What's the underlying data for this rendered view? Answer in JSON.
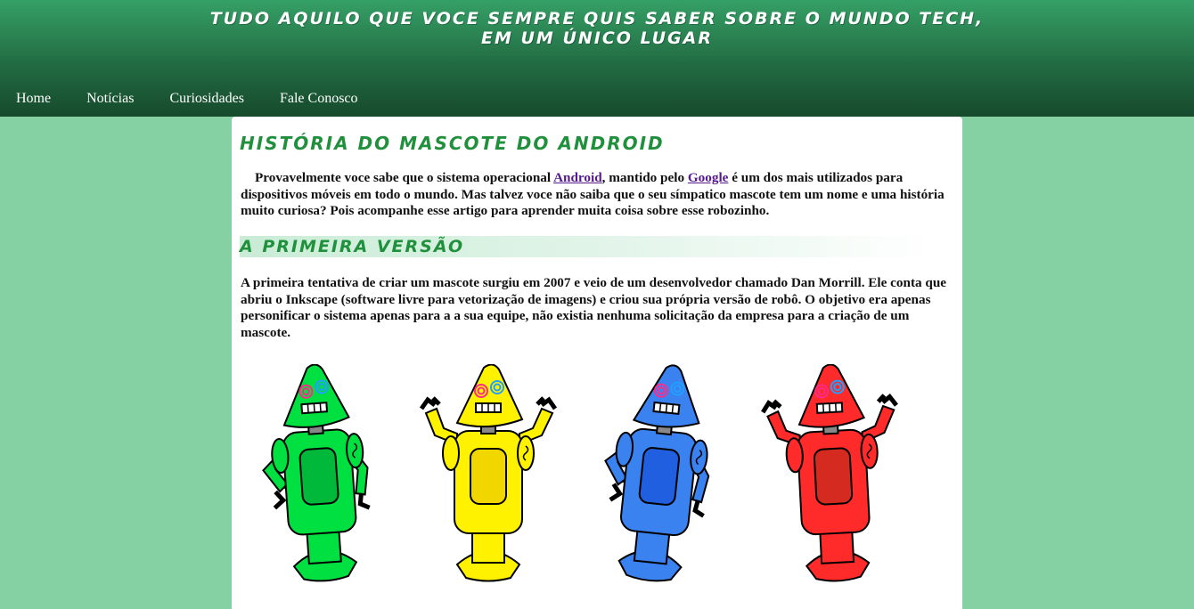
{
  "header": {
    "title_line1": "Tudo aquilo que voce sempre quis saber sobre o mundo tech,",
    "title_line2": "em um único lugar"
  },
  "nav": {
    "items": [
      {
        "label": "Home"
      },
      {
        "label": "Notícias"
      },
      {
        "label": "Curiosidades"
      },
      {
        "label": "Fale Conosco"
      }
    ]
  },
  "article": {
    "title": "História do mascote do Android",
    "intro": {
      "part1": "Provavelmente voce sabe que o sistema operacional ",
      "link1": "Android",
      "part2": ", mantido pelo ",
      "link2": "Google",
      "part3": " é um dos mais utilizados para dispositivos móveis em todo o mundo. Mas talvez voce não saiba que o seu símpatico mascote tem um nome e uma história muito curiosa? Pois acompanhe esse artigo para aprender muita coisa sobre esse robozinho."
    },
    "section1": {
      "heading": "A primeira versão",
      "text": "A primeira tentativa de criar um mascote surgiu em 2007 e veio de um desenvolvedor chamado Dan Morrill. Ele conta que abriu o Inkscape (software livre para vetorização de imagens) e criou sua própria versão de robô. O objetivo era apenas personificar o sistema apenas para a a sua equipe, não existia nenhuma solicitação da empresa para a criação de um mascote."
    }
  },
  "robots": [
    {
      "color": "#00e040",
      "dark": "#00b83a"
    },
    {
      "color": "#fff200",
      "dark": "#f2d600"
    },
    {
      "color": "#3a82f0",
      "dark": "#1f5fe0"
    },
    {
      "color": "#ff2a2a",
      "dark": "#d42a1f"
    }
  ],
  "colors": {
    "page_bg": "#85d1a3",
    "header_top": "#35a066",
    "header_bottom": "#164a2c",
    "heading": "#21903c",
    "link": "#551a8b"
  }
}
